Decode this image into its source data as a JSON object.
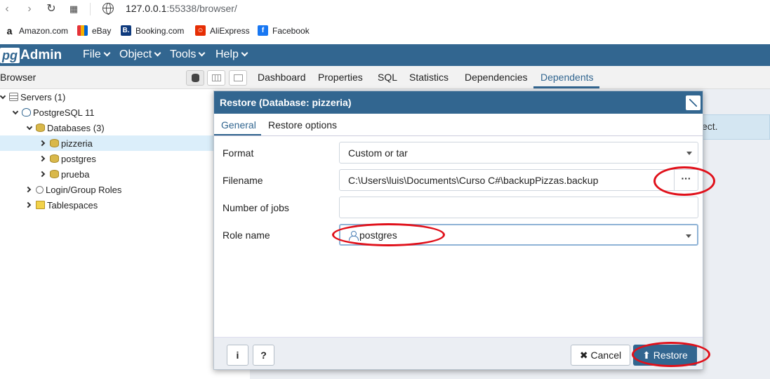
{
  "browser": {
    "url_host": "127.0.0.1",
    "url_rest": ":55338/browser/",
    "bookmarks": [
      "Amazon.com",
      "eBay",
      "Booking.com",
      "AliExpress",
      "Facebook"
    ]
  },
  "app": {
    "logo_pg": "pg",
    "logo_admin": "Admin",
    "menus": [
      "File",
      "Object",
      "Tools",
      "Help"
    ]
  },
  "browser_panel": {
    "title": "Browser",
    "tree": [
      {
        "label": "Servers (1)"
      },
      {
        "label": "PostgreSQL 11"
      },
      {
        "label": "Databases (3)"
      },
      {
        "label": "pizzeria"
      },
      {
        "label": "postgres"
      },
      {
        "label": "prueba"
      },
      {
        "label": "Login/Group Roles"
      },
      {
        "label": "Tablespaces"
      }
    ]
  },
  "main_tabs": [
    "Dashboard",
    "Properties",
    "SQL",
    "Statistics",
    "Dependencies",
    "Dependents"
  ],
  "info_text": "ect.",
  "dialog": {
    "title": "Restore (Database: pizzeria)",
    "tabs": [
      "General",
      "Restore options"
    ],
    "fields": {
      "format_label": "Format",
      "format_value": "Custom or tar",
      "filename_label": "Filename",
      "filename_value": "C:\\Users\\luis\\Documents\\Curso C#\\backupPizzas.backup",
      "browse_label": "···",
      "jobs_label": "Number of jobs",
      "jobs_value": "",
      "role_label": "Role name",
      "role_value": "postgres"
    },
    "footer": {
      "info_label": "i",
      "help_label": "?",
      "cancel_label": "Cancel",
      "restore_label": "Restore"
    }
  },
  "colors": {
    "brand": "#326690",
    "annotation": "#e0101a"
  }
}
